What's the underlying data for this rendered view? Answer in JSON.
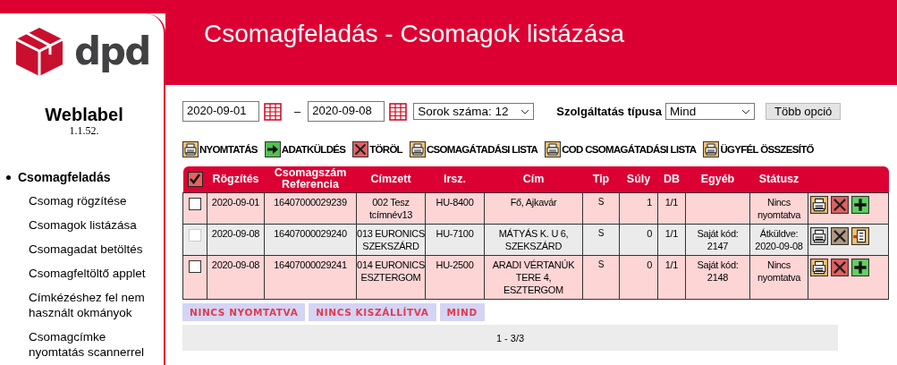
{
  "sidebar": {
    "logo_text": "dpd",
    "app_name": "Weblabel",
    "version": "1.1.52.",
    "menu": [
      {
        "label": "Csomagfeladás",
        "selected": true,
        "children": [
          {
            "label": "Csomag rögzítése",
            "selected": false
          },
          {
            "label": "Csomagok listázása",
            "selected": false
          },
          {
            "label": "Csomagadat betöltés",
            "selected": false
          },
          {
            "label": "Csomagfeltöltő applet",
            "selected": false
          },
          {
            "label": "Címkézéshez fel nem használt okmányok",
            "selected": false
          },
          {
            "label": "Csomagcímke nyomtatás scannerrel",
            "selected": false
          }
        ]
      }
    ]
  },
  "page_title": "Csomagfeladás - Csomagok listázása",
  "filters": {
    "date_from": "2020-09-01",
    "separator": "–",
    "date_to": "2020-09-08",
    "rows_select": "Sorok száma: 12",
    "service_label": "Szolgáltatás típusa",
    "service_select": "Mind",
    "more_button": "Több opció"
  },
  "toolbar": [
    {
      "kind": "print",
      "label": "NYOMTATÁS"
    },
    {
      "kind": "send",
      "label": "ADATKÜLDÉS"
    },
    {
      "kind": "delete",
      "label": "TÖRÖL"
    },
    {
      "kind": "list",
      "label": "CSOMAGÁTADÁSI LISTA"
    },
    {
      "kind": "list",
      "label": "COD CSOMAGÁTADÁSI LISTA"
    },
    {
      "kind": "list",
      "label": "ÜGYFÉL ÖSSZESÍTŐ"
    }
  ],
  "table": {
    "select_all_checked": true,
    "columns": [
      "Rögzítés",
      "Csomagszám Referencia",
      "Címzett",
      "Irsz.",
      "Cím",
      "Tip",
      "Súly",
      "DB",
      "Egyéb",
      "Státusz"
    ],
    "rows": [
      {
        "sent": false,
        "checked": false,
        "cells": [
          "2020-09-01",
          "16407000029239",
          "002 Tesz tcímnév13",
          "HU-8400",
          "Fő, Ajkavár",
          "S",
          "1",
          "1/1",
          "",
          "Nincs nyomtatva"
        ]
      },
      {
        "sent": true,
        "checked": false,
        "cells": [
          "2020-09-08",
          "16407000029240",
          "013 EURONICS SZEKSZÁRD",
          "HU-7100",
          "MÁTYÁS K. U 6, SZEKSZÁRD",
          "S",
          "0",
          "1/1",
          "Saját kód: 2147",
          "Átküldve: 2020-09-08"
        ]
      },
      {
        "sent": false,
        "checked": false,
        "cells": [
          "2020-09-08",
          "16407000029241",
          "014 EURONICS ESZTERGOM",
          "HU-2500",
          "ARADI VÉRTANÚK TERE 4, ESZTERGOM",
          "S",
          "0",
          "1/1",
          "Saját kód: 2148",
          "Nincs nyomtatva"
        ]
      }
    ]
  },
  "status_tabs": [
    {
      "label": "NINCS NYOMTATVA",
      "selected": false
    },
    {
      "label": "NINCS KISZÁLLÍTVA",
      "selected": false
    },
    {
      "label": "MIND",
      "selected": false
    }
  ],
  "pager": "1 - 3/3"
}
